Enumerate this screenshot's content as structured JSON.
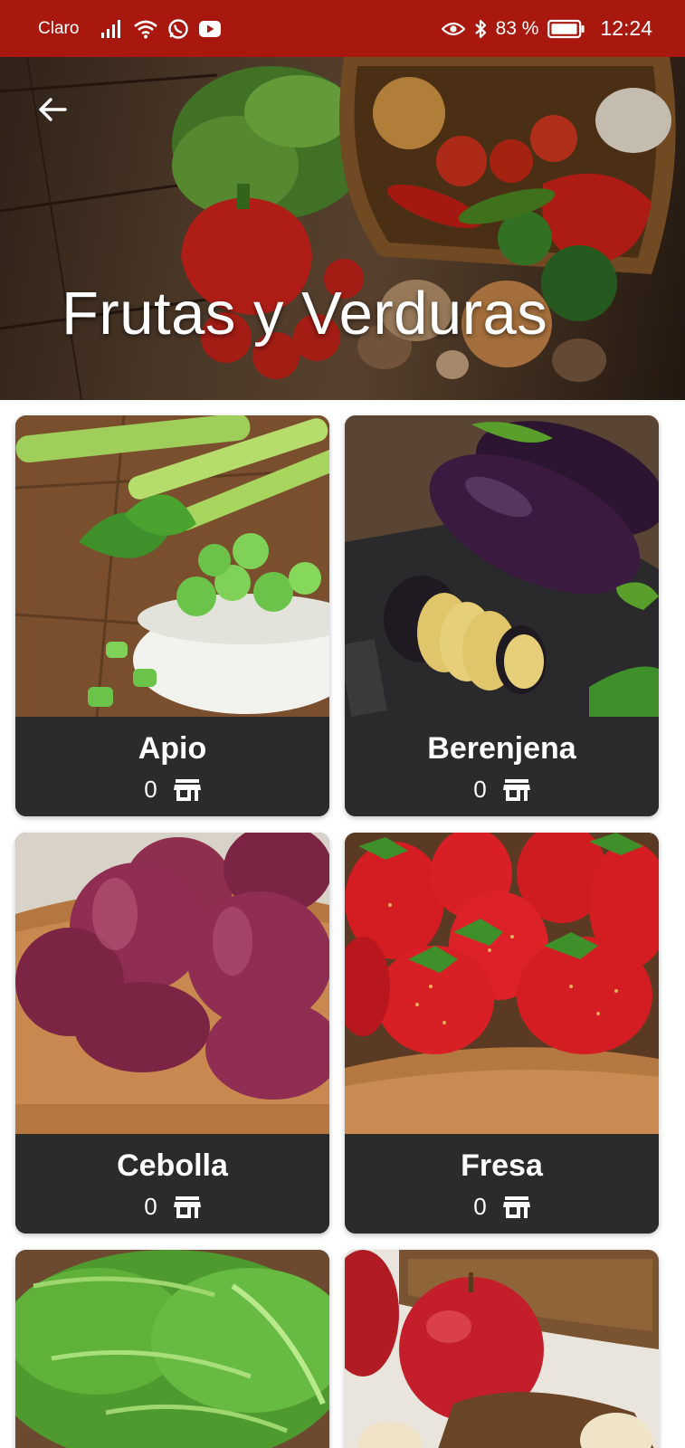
{
  "status_bar": {
    "carrier": "Claro",
    "battery_percent": "83 %",
    "time": "12:24",
    "icons": [
      "signal-icon",
      "wifi-icon",
      "whatsapp-icon",
      "youtube-icon",
      "eye-icon",
      "bluetooth-icon",
      "battery-icon"
    ],
    "background_color": "#a8180f"
  },
  "header": {
    "title": "Frutas y Verduras",
    "back_icon": "arrow-left-icon"
  },
  "products": [
    {
      "name": "Apio",
      "count": "0",
      "icon": "store-icon"
    },
    {
      "name": "Berenjena",
      "count": "0",
      "icon": "store-icon"
    },
    {
      "name": "Cebolla",
      "count": "0",
      "icon": "store-icon"
    },
    {
      "name": "Fresa",
      "count": "0",
      "icon": "store-icon"
    },
    {
      "name": "",
      "count": "",
      "icon": ""
    },
    {
      "name": "",
      "count": "",
      "icon": ""
    }
  ],
  "colors": {
    "card_footer": "#2b2b2b",
    "accent": "#a8180f"
  }
}
